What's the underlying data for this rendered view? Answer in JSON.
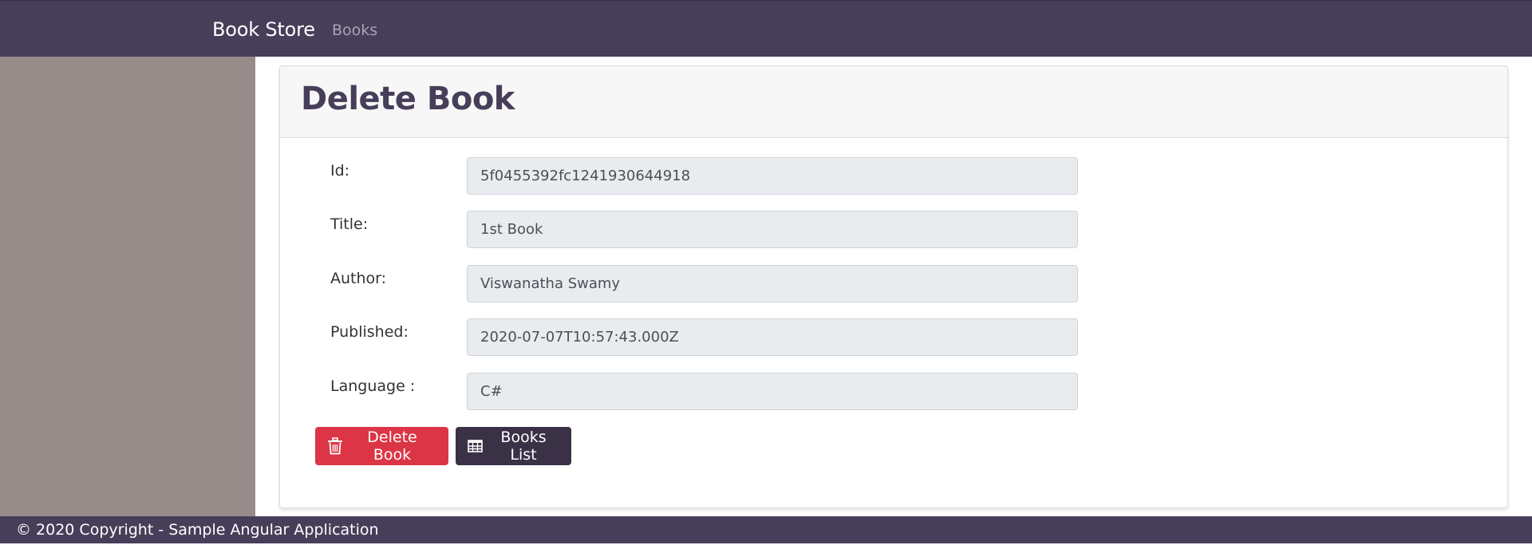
{
  "navbar": {
    "brand": "Book Store",
    "links": [
      "Books"
    ]
  },
  "card": {
    "title": "Delete Book"
  },
  "fields": [
    {
      "label": "Id:",
      "value": "5f0455392fc1241930644918"
    },
    {
      "label": "Title:",
      "value": "1st Book"
    },
    {
      "label": "Author:",
      "value": "Viswanatha Swamy"
    },
    {
      "label": "Published:",
      "value": "2020-07-07T10:57:43.000Z"
    },
    {
      "label": "Language :",
      "value": "C#"
    }
  ],
  "actions": {
    "delete_label": "Delete Book",
    "delete_icon": "trash-icon",
    "list_label": "Books List",
    "list_icon": "table-icon"
  },
  "footer": {
    "text": "© 2020 Copyright - Sample Angular Application"
  },
  "colors": {
    "navbar": "#473e5a",
    "sidebar": "#988c8b",
    "danger": "#dc3545",
    "dark": "#3a3147",
    "input_bg": "#e9ecef"
  }
}
